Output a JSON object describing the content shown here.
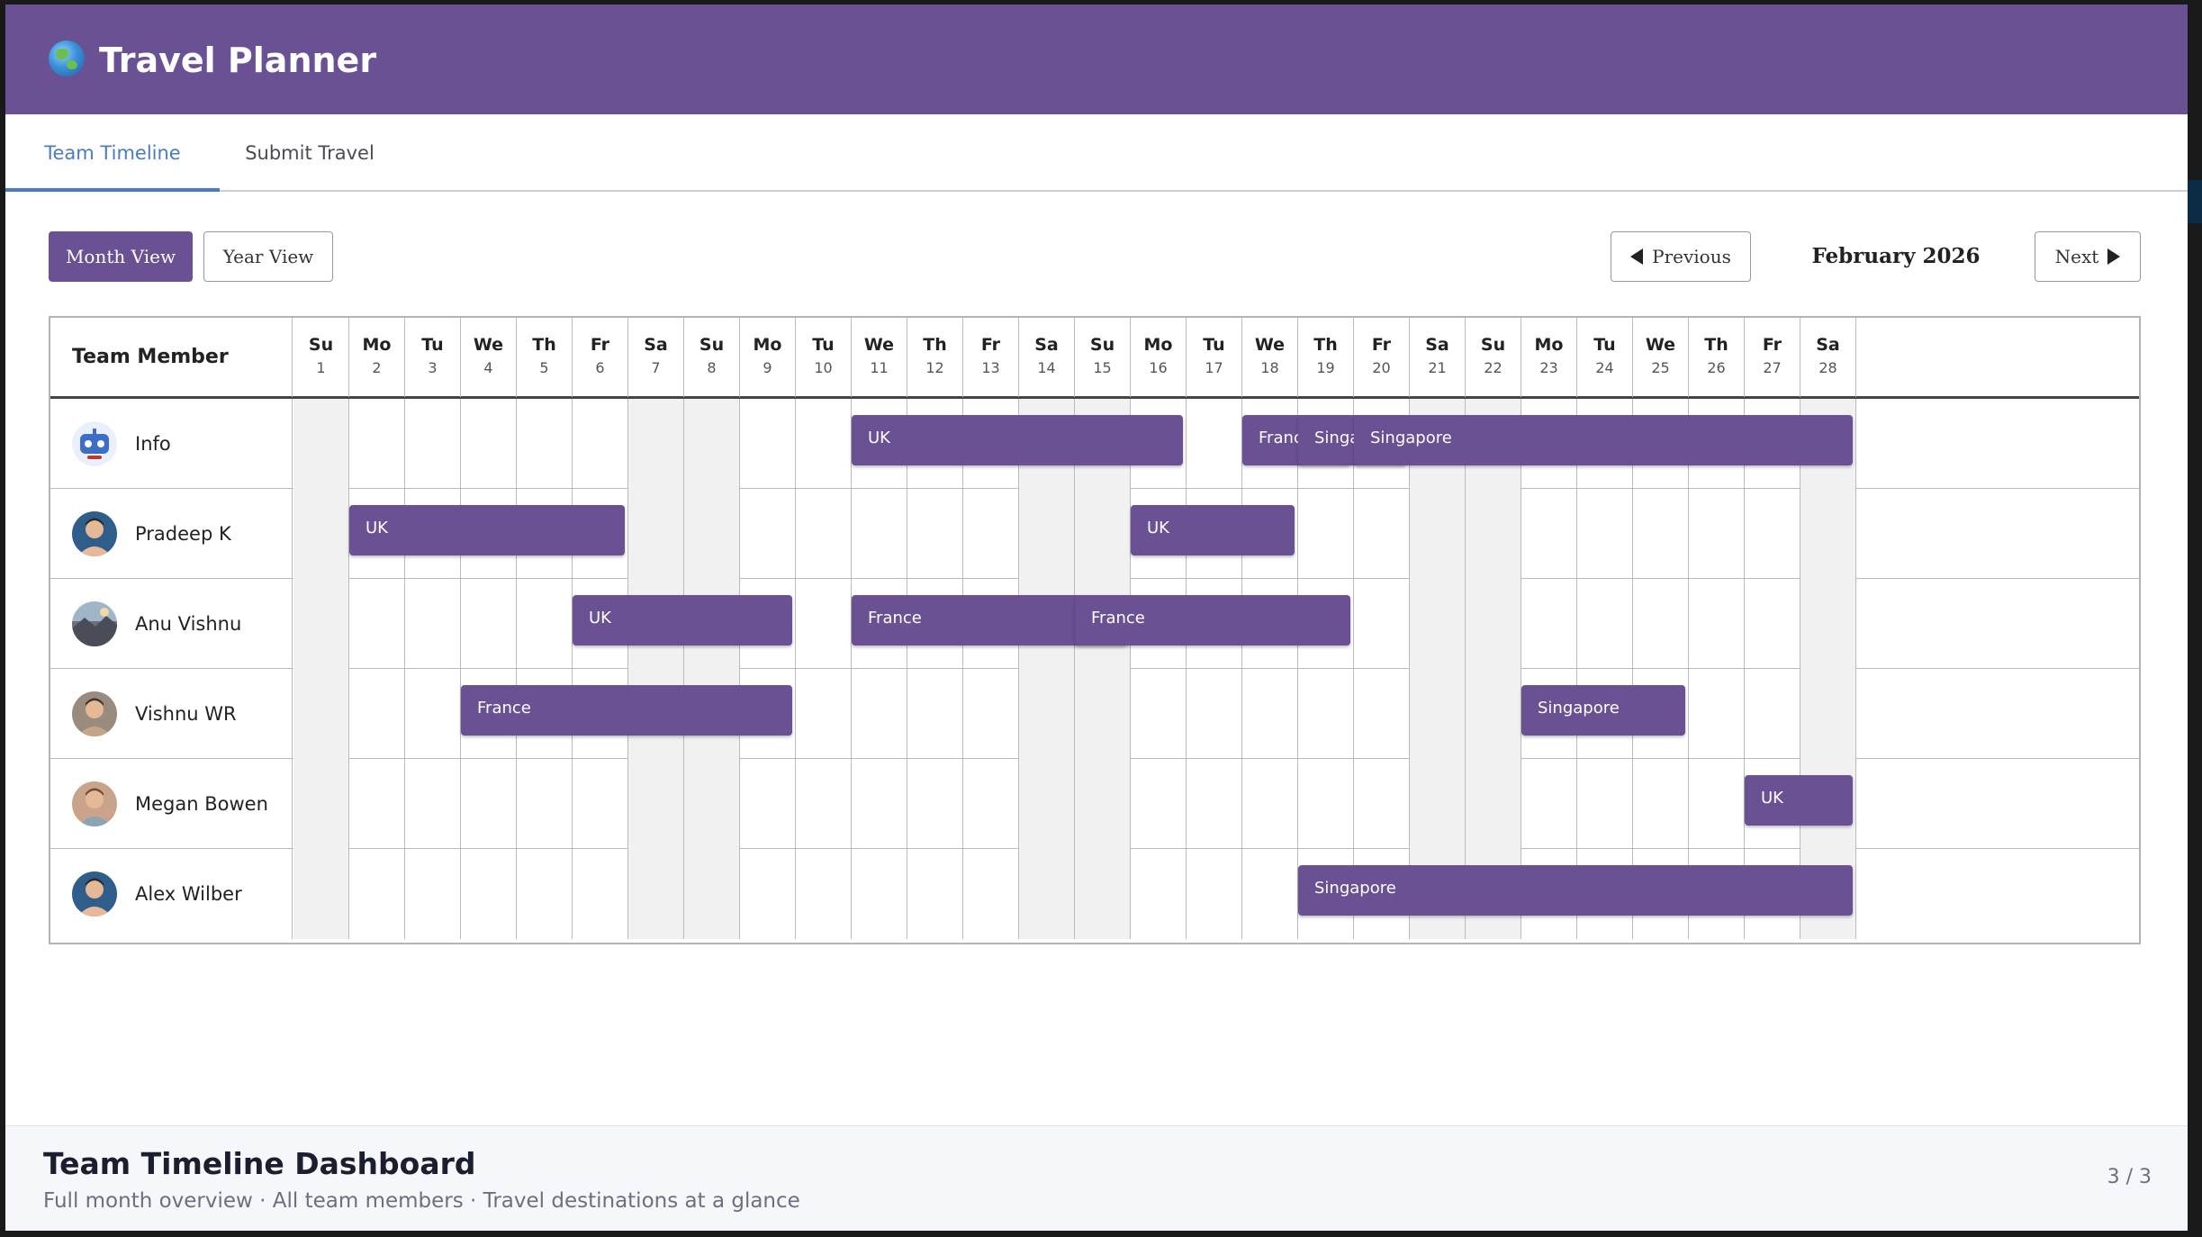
{
  "app": {
    "title": "Travel Planner"
  },
  "tabs": [
    {
      "label": "Team Timeline",
      "active": true
    },
    {
      "label": "Submit Travel",
      "active": false
    }
  ],
  "toolbar": {
    "month_view": "Month View",
    "year_view": "Year View",
    "previous": "Previous",
    "current_month": "February 2026",
    "next": "Next"
  },
  "grid": {
    "member_header": "Team Member",
    "days": [
      {
        "dow": "Su",
        "num": "1"
      },
      {
        "dow": "Mo",
        "num": "2"
      },
      {
        "dow": "Tu",
        "num": "3"
      },
      {
        "dow": "We",
        "num": "4"
      },
      {
        "dow": "Th",
        "num": "5"
      },
      {
        "dow": "Fr",
        "num": "6"
      },
      {
        "dow": "Sa",
        "num": "7"
      },
      {
        "dow": "Su",
        "num": "8"
      },
      {
        "dow": "Mo",
        "num": "9"
      },
      {
        "dow": "Tu",
        "num": "10"
      },
      {
        "dow": "We",
        "num": "11"
      },
      {
        "dow": "Th",
        "num": "12"
      },
      {
        "dow": "Fr",
        "num": "13"
      },
      {
        "dow": "Sa",
        "num": "14"
      },
      {
        "dow": "Su",
        "num": "15"
      },
      {
        "dow": "Mo",
        "num": "16"
      },
      {
        "dow": "Tu",
        "num": "17"
      },
      {
        "dow": "We",
        "num": "18"
      },
      {
        "dow": "Th",
        "num": "19"
      },
      {
        "dow": "Fr",
        "num": "20"
      },
      {
        "dow": "Sa",
        "num": "21"
      },
      {
        "dow": "Su",
        "num": "22"
      },
      {
        "dow": "Mo",
        "num": "23"
      },
      {
        "dow": "Tu",
        "num": "24"
      },
      {
        "dow": "We",
        "num": "25"
      },
      {
        "dow": "Th",
        "num": "26"
      },
      {
        "dow": "Fr",
        "num": "27"
      },
      {
        "dow": "Sa",
        "num": "28"
      }
    ],
    "members": [
      {
        "name": "Info",
        "avatar": "bot-avatar",
        "trips": [
          {
            "label": "UK",
            "start": 11,
            "end": 16
          },
          {
            "label": "France",
            "start": 18,
            "end": 19
          },
          {
            "label": "Singapore",
            "start": 19,
            "end": 20
          },
          {
            "label": "Singapore",
            "start": 20,
            "end": 28
          }
        ]
      },
      {
        "name": "Pradeep K",
        "avatar": "person-avatar",
        "trips": [
          {
            "label": "UK",
            "start": 2,
            "end": 6
          },
          {
            "label": "UK",
            "start": 16,
            "end": 18
          }
        ]
      },
      {
        "name": "Anu Vishnu",
        "avatar": "landscape-avatar",
        "trips": [
          {
            "label": "UK",
            "start": 6,
            "end": 9
          },
          {
            "label": "France",
            "start": 11,
            "end": 15
          },
          {
            "label": "France",
            "start": 15,
            "end": 19
          }
        ]
      },
      {
        "name": "Vishnu WR",
        "avatar": "person-avatar",
        "trips": [
          {
            "label": "France",
            "start": 4,
            "end": 9
          },
          {
            "label": "Singapore",
            "start": 23,
            "end": 25
          }
        ]
      },
      {
        "name": "Megan Bowen",
        "avatar": "person-avatar",
        "trips": [
          {
            "label": "UK",
            "start": 27,
            "end": 28
          }
        ]
      },
      {
        "name": "Alex Wilber",
        "avatar": "person-avatar",
        "trips": [
          {
            "label": "Singapore",
            "start": 19,
            "end": 28
          }
        ]
      }
    ]
  },
  "footer": {
    "title": "Team Timeline Dashboard",
    "subtitle": "Full month overview · All team members · Travel destinations at a glance",
    "page": "3 / 3"
  },
  "colors": {
    "brand": "#6a5193",
    "tab_active": "#4a7cc0",
    "weekend": "#f1f1f1"
  }
}
